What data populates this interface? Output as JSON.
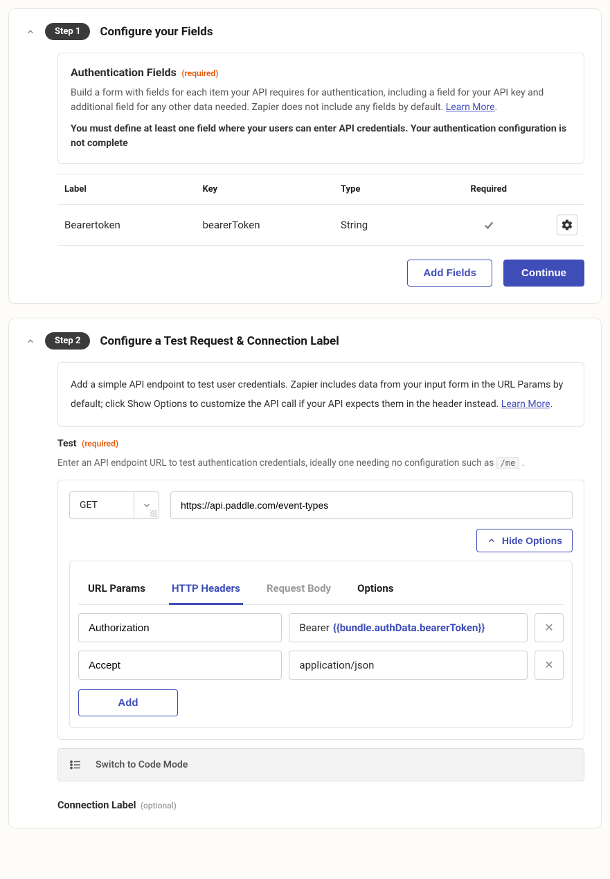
{
  "step1": {
    "badge": "Step 1",
    "title": "Configure your Fields",
    "box": {
      "heading": "Authentication Fields",
      "required": "(required)",
      "desc_prefix": "Build a form with fields for each item your API requires for authentication, including a field for your API key and additional field for any other data needed. Zapier does not include any fields by default. ",
      "learn_more": "Learn More",
      "bold_note": "You must define at least one field where your users can enter API credentials. Your authentication configuration is not complete"
    },
    "table": {
      "headers": {
        "label": "Label",
        "key": "Key",
        "type": "Type",
        "required": "Required"
      },
      "row": {
        "label": "Bearertoken",
        "key": "bearerToken",
        "type": "String"
      }
    },
    "buttons": {
      "add_fields": "Add Fields",
      "continue": "Continue"
    }
  },
  "step2": {
    "badge": "Step 2",
    "title": "Configure a Test Request & Connection Label",
    "box": {
      "desc_prefix": "Add a simple API endpoint to test user credentials. Zapier includes data from your input form in the URL Params by default; click Show Options to customize the API call if your API expects them in the header instead. ",
      "learn_more": "Learn More"
    },
    "test": {
      "label": "Test",
      "required": "(required)",
      "hint_prefix": "Enter an API endpoint URL to test authentication credentials, ideally one needing no configuration such as ",
      "hint_code": "/me",
      "method": "GET",
      "url": "https://api.paddle.com/event-types",
      "hide_options": "Hide Options"
    },
    "tabs": {
      "url_params": "URL Params",
      "http_headers": "HTTP Headers",
      "request_body": "Request Body",
      "options": "Options"
    },
    "headers": [
      {
        "key": "Authorization",
        "value_prefix": "Bearer ",
        "value_template": "{{bundle.authData.bearerToken}}"
      },
      {
        "key": "Accept",
        "value_prefix": "application/json",
        "value_template": ""
      }
    ],
    "add_btn": "Add",
    "switch_code": "Switch to Code Mode",
    "conn_label": {
      "label": "Connection Label",
      "optional": "(optional)"
    }
  }
}
